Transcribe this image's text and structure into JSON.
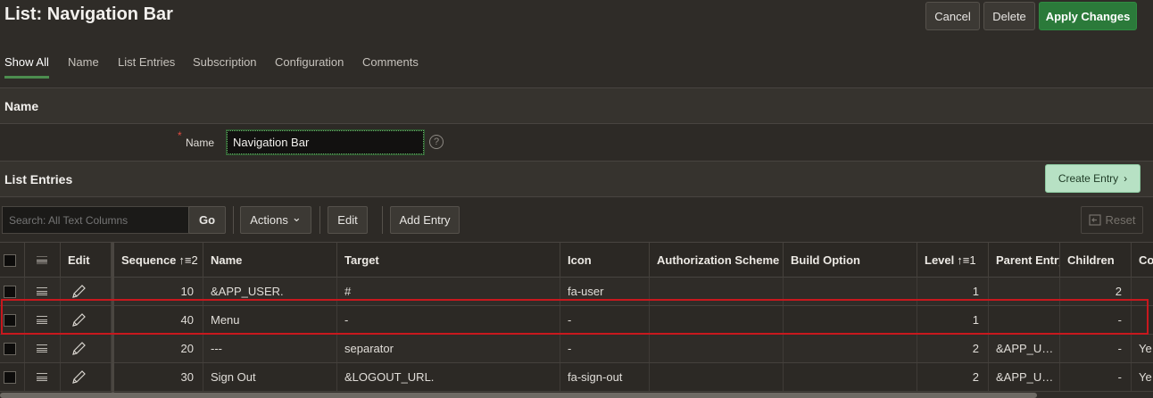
{
  "header": {
    "title": "List: Navigation Bar",
    "buttons": {
      "cancel": "Cancel",
      "delete": "Delete",
      "apply": "Apply Changes"
    }
  },
  "tabs": [
    "Show All",
    "Name",
    "List Entries",
    "Subscription",
    "Configuration",
    "Comments"
  ],
  "name_section": {
    "title": "Name",
    "label": "Name",
    "required_mark": "*",
    "value": "Navigation Bar",
    "help": "?"
  },
  "list_entries": {
    "title": "List Entries",
    "create_button": "Create Entry",
    "create_chevron": "›",
    "toolbar": {
      "search_placeholder": "Search: All Text Columns",
      "go": "Go",
      "actions": "Actions",
      "actions_chevron": "⌄",
      "edit": "Edit",
      "add_entry": "Add Entry",
      "reset": "Reset"
    },
    "columns": {
      "edit": "Edit",
      "sequence": "Sequence",
      "sequence_sort": "↑≡2",
      "name": "Name",
      "target": "Target",
      "icon": "Icon",
      "authorization": "Authorization Scheme",
      "build_option": "Build Option",
      "level": "Level",
      "level_sort": "↑≡1",
      "parent": "Parent Entry",
      "children": "Children",
      "extra": "Co"
    },
    "rows": [
      {
        "sequence": "10",
        "name": "&APP_USER.",
        "target": "#",
        "icon": "fa-user",
        "authorization": "",
        "build_option": "",
        "level": "1",
        "parent": "",
        "children": "2",
        "extra": ""
      },
      {
        "sequence": "40",
        "name": "Menu",
        "target": "-",
        "icon": "-",
        "authorization": "",
        "build_option": "",
        "level": "1",
        "parent": "",
        "children": "-",
        "extra": ""
      },
      {
        "sequence": "20",
        "name": "---",
        "target": "separator",
        "icon": "-",
        "authorization": "",
        "build_option": "",
        "level": "2",
        "parent": "&APP_U…",
        "children": "-",
        "extra": "Ye"
      },
      {
        "sequence": "30",
        "name": "Sign Out",
        "target": "&LOGOUT_URL.",
        "icon": "fa-sign-out",
        "authorization": "",
        "build_option": "",
        "level": "2",
        "parent": "&APP_U…",
        "children": "-",
        "extra": "Ye"
      }
    ]
  }
}
